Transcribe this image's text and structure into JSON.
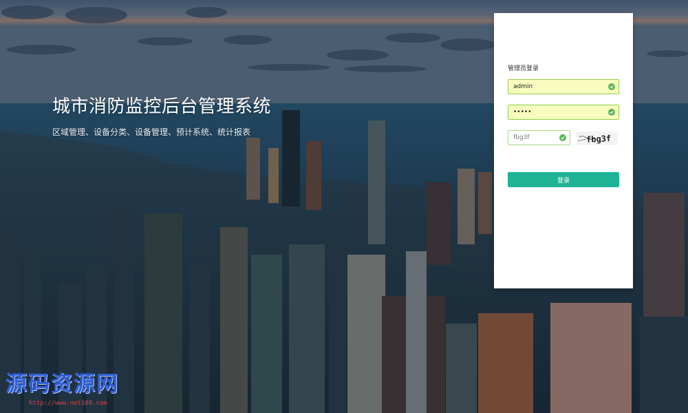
{
  "hero": {
    "title": "城市消防监控后台管理系统",
    "subtitle": "区域管理、设备分类、设备管理、预计系统、统计报表"
  },
  "login": {
    "title": "管理员登录",
    "username": "admin",
    "password": "•••••",
    "captcha_value": "fbg3f",
    "captcha_image_text": "fbg3f",
    "submit_label": "登录"
  },
  "watermark": {
    "text": "源码资源网",
    "url": "http://www.net188.com"
  },
  "colors": {
    "accent": "#1fb396",
    "valid": "#5cb85c",
    "field_bg": "#f8fcbf"
  }
}
